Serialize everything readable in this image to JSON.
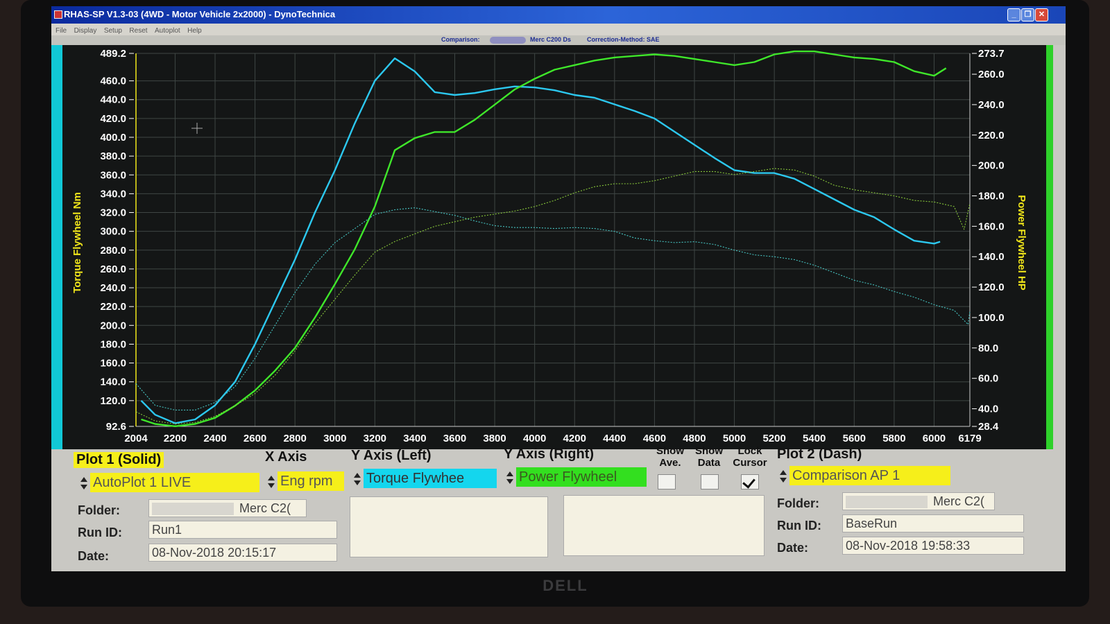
{
  "window": {
    "title": "RHAS-SP V1.3-03  (4WD - Motor Vehicle 2x2000) - DynoTechnica",
    "menu": [
      "File",
      "Display",
      "Setup",
      "Reset",
      "Autoplot",
      "Help"
    ],
    "buttons": {
      "minimize": "_",
      "maximize": "❐",
      "close": "✕"
    }
  },
  "status": {
    "comparison_label": "Comparison:",
    "comparison_value": "Merc C200 Ds",
    "correction": "Correction-Method: SAE"
  },
  "chart_data": {
    "type": "line",
    "ylabel": "Torque Flywheel Nm",
    "y2label": "Power Flywheel HP",
    "xlim": [
      2004,
      6179
    ],
    "ylim": [
      92.6,
      489.2
    ],
    "y2lim": [
      28.4,
      273.7
    ],
    "x_ticks": [
      "2004",
      "2200",
      "2400",
      "2600",
      "2800",
      "3000",
      "3200",
      "3400",
      "3600",
      "3800",
      "4000",
      "4200",
      "4400",
      "4600",
      "4800",
      "5000",
      "5200",
      "5400",
      "5600",
      "5800",
      "6000",
      "6179"
    ],
    "y_ticks": [
      "92.6",
      "120.0",
      "140.0",
      "160.0",
      "180.0",
      "200.0",
      "220.0",
      "240.0",
      "260.0",
      "280.0",
      "300.0",
      "320.0",
      "340.0",
      "360.0",
      "380.0",
      "400.0",
      "420.0",
      "440.0",
      "460.0",
      "489.2"
    ],
    "y2_ticks": [
      "28.4",
      "40.0",
      "60.0",
      "80.0",
      "100.0",
      "120.0",
      "140.0",
      "160.0",
      "180.0",
      "200.0",
      "220.0",
      "240.0",
      "260.0",
      "273.7"
    ],
    "series": [
      {
        "color": "#2cc8ef",
        "axis": "left",
        "style": "solid",
        "points": [
          [
            2030,
            120
          ],
          [
            2100,
            105
          ],
          [
            2200,
            96
          ],
          [
            2300,
            100
          ],
          [
            2400,
            115
          ],
          [
            2500,
            140
          ],
          [
            2600,
            180
          ],
          [
            2700,
            225
          ],
          [
            2800,
            270
          ],
          [
            2900,
            320
          ],
          [
            3000,
            365
          ],
          [
            3100,
            415
          ],
          [
            3200,
            460
          ],
          [
            3300,
            484
          ],
          [
            3400,
            470
          ],
          [
            3500,
            448
          ],
          [
            3600,
            445
          ],
          [
            3700,
            447
          ],
          [
            3800,
            451
          ],
          [
            3900,
            454
          ],
          [
            4000,
            453
          ],
          [
            4100,
            450
          ],
          [
            4200,
            445
          ],
          [
            4300,
            442
          ],
          [
            4400,
            435
          ],
          [
            4500,
            428
          ],
          [
            4600,
            420
          ],
          [
            4700,
            406
          ],
          [
            4800,
            392
          ],
          [
            4900,
            378
          ],
          [
            5000,
            365
          ],
          [
            5100,
            362
          ],
          [
            5200,
            362
          ],
          [
            5300,
            356
          ],
          [
            5400,
            345
          ],
          [
            5500,
            334
          ],
          [
            5600,
            323
          ],
          [
            5700,
            315
          ],
          [
            5800,
            302
          ],
          [
            5900,
            290
          ],
          [
            6000,
            287
          ],
          [
            6030,
            289
          ]
        ]
      },
      {
        "color": "#3fe62a",
        "axis": "right",
        "style": "solid",
        "points": [
          [
            2030,
            33
          ],
          [
            2100,
            30
          ],
          [
            2200,
            28.5
          ],
          [
            2300,
            30
          ],
          [
            2400,
            34
          ],
          [
            2500,
            42
          ],
          [
            2600,
            52
          ],
          [
            2700,
            65
          ],
          [
            2800,
            80
          ],
          [
            2900,
            100
          ],
          [
            3000,
            122
          ],
          [
            3100,
            145
          ],
          [
            3200,
            173
          ],
          [
            3300,
            210
          ],
          [
            3400,
            218
          ],
          [
            3500,
            222
          ],
          [
            3600,
            222
          ],
          [
            3700,
            230
          ],
          [
            3800,
            240
          ],
          [
            3900,
            250
          ],
          [
            4000,
            257
          ],
          [
            4100,
            263
          ],
          [
            4200,
            266
          ],
          [
            4300,
            269
          ],
          [
            4400,
            271
          ],
          [
            4500,
            272
          ],
          [
            4600,
            273
          ],
          [
            4700,
            272
          ],
          [
            4800,
            270
          ],
          [
            4900,
            268
          ],
          [
            5000,
            266
          ],
          [
            5100,
            268
          ],
          [
            5200,
            273
          ],
          [
            5300,
            275
          ],
          [
            5400,
            275
          ],
          [
            5500,
            273
          ],
          [
            5600,
            271
          ],
          [
            5700,
            270
          ],
          [
            5800,
            268
          ],
          [
            5900,
            262
          ],
          [
            6000,
            259
          ],
          [
            6060,
            264
          ]
        ]
      },
      {
        "color": "#47c6c4",
        "axis": "left",
        "style": "dashed",
        "points": [
          [
            2004,
            138
          ],
          [
            2100,
            115
          ],
          [
            2200,
            110
          ],
          [
            2300,
            110
          ],
          [
            2400,
            118
          ],
          [
            2500,
            135
          ],
          [
            2600,
            165
          ],
          [
            2700,
            200
          ],
          [
            2800,
            235
          ],
          [
            2900,
            265
          ],
          [
            3000,
            288
          ],
          [
            3100,
            303
          ],
          [
            3200,
            318
          ],
          [
            3300,
            323
          ],
          [
            3400,
            325
          ],
          [
            3500,
            321
          ],
          [
            3600,
            317
          ],
          [
            3700,
            311
          ],
          [
            3800,
            306
          ],
          [
            3900,
            304
          ],
          [
            4000,
            304
          ],
          [
            4100,
            303
          ],
          [
            4200,
            304
          ],
          [
            4300,
            303
          ],
          [
            4400,
            300
          ],
          [
            4500,
            293
          ],
          [
            4600,
            290
          ],
          [
            4700,
            288
          ],
          [
            4800,
            289
          ],
          [
            4900,
            286
          ],
          [
            5000,
            280
          ],
          [
            5100,
            275
          ],
          [
            5200,
            273
          ],
          [
            5300,
            270
          ],
          [
            5400,
            264
          ],
          [
            5500,
            256
          ],
          [
            5600,
            248
          ],
          [
            5700,
            243
          ],
          [
            5800,
            236
          ],
          [
            5900,
            230
          ],
          [
            6000,
            222
          ],
          [
            6100,
            216
          ],
          [
            6170,
            201
          ],
          [
            6179,
            215
          ]
        ]
      },
      {
        "color": "#88c83a",
        "axis": "right",
        "style": "dashed",
        "points": [
          [
            2004,
            38
          ],
          [
            2100,
            32
          ],
          [
            2200,
            30
          ],
          [
            2300,
            31
          ],
          [
            2400,
            35
          ],
          [
            2500,
            42
          ],
          [
            2600,
            50
          ],
          [
            2700,
            62
          ],
          [
            2800,
            78
          ],
          [
            2900,
            96
          ],
          [
            3000,
            112
          ],
          [
            3100,
            128
          ],
          [
            3200,
            143
          ],
          [
            3300,
            150
          ],
          [
            3400,
            155
          ],
          [
            3500,
            160
          ],
          [
            3600,
            163
          ],
          [
            3700,
            166
          ],
          [
            3800,
            168
          ],
          [
            3900,
            170
          ],
          [
            4000,
            173
          ],
          [
            4100,
            177
          ],
          [
            4200,
            182
          ],
          [
            4300,
            186
          ],
          [
            4400,
            188
          ],
          [
            4500,
            188
          ],
          [
            4600,
            190
          ],
          [
            4700,
            193
          ],
          [
            4800,
            196
          ],
          [
            4900,
            196
          ],
          [
            5000,
            194
          ],
          [
            5100,
            196
          ],
          [
            5200,
            198
          ],
          [
            5300,
            197
          ],
          [
            5400,
            193
          ],
          [
            5500,
            187
          ],
          [
            5600,
            184
          ],
          [
            5700,
            182
          ],
          [
            5800,
            180
          ],
          [
            5900,
            177
          ],
          [
            6000,
            176
          ],
          [
            6100,
            173
          ],
          [
            6150,
            158
          ],
          [
            6179,
            175
          ]
        ]
      }
    ]
  },
  "panel": {
    "plot1": {
      "header": "Plot 1 (Solid)",
      "select": "AutoPlot 1 LIVE"
    },
    "x_axis": {
      "header": "X Axis",
      "select": "Eng rpm"
    },
    "y_left": {
      "header": "Y Axis (Left)",
      "select": "Torque Flywhee"
    },
    "y_right": {
      "header": "Y Axis (Right)",
      "select": "Power Flywheel"
    },
    "show_ave": {
      "line1": "Show",
      "line2": "Ave."
    },
    "show_data": {
      "line1": "Show",
      "line2": "Data"
    },
    "lock_cursor": {
      "line1": "Lock",
      "line2": "Cursor"
    },
    "plot2": {
      "header": "Plot 2 (Dash)",
      "select": "Comparison AP 1"
    },
    "left_info": {
      "folder_label": "Folder:",
      "folder_value": "Merc C2(",
      "run_label": "Run ID:",
      "run_value": "Run1",
      "date_label": "Date:",
      "date_value": "08-Nov-2018  20:15:17"
    },
    "right_info": {
      "folder_label": "Folder:",
      "folder_value": "Merc C2(",
      "run_label": "Run ID:",
      "run_value": "BaseRun",
      "date_label": "Date:",
      "date_value": "08-Nov-2018  19:58:33"
    }
  },
  "monitor": {
    "brand": "DELL"
  },
  "colors": {
    "torque": "#2cc8ef",
    "power": "#3fe62a",
    "left_axis": "#f2e71a",
    "plot_bg": "#141616",
    "grid": "#3f4644"
  }
}
